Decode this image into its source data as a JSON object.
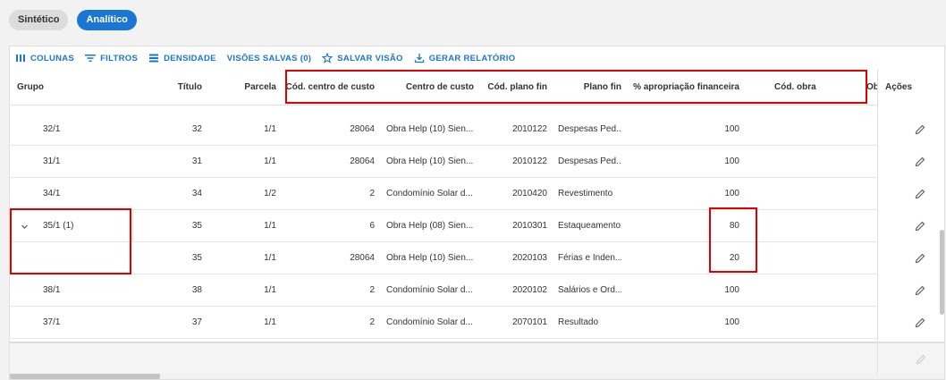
{
  "view_toggle": {
    "synthetic_label": "Sintético",
    "analytic_label": "Analítico"
  },
  "toolbar": {
    "columns_label": "COLUNAS",
    "filters_label": "FILTROS",
    "density_label": "DENSIDADE",
    "saved_views_label": "VISÕES SALVAS (0)",
    "save_view_label": "SALVAR VISÃO",
    "report_label": "GERAR RELATÓRIO"
  },
  "columns": {
    "grupo": "Grupo",
    "titulo": "Título",
    "parcela": "Parcela",
    "cod_centro": "Cód. centro de custo",
    "centro": "Centro de custo",
    "cod_plano": "Cód. plano fin",
    "plano": "Plano fin",
    "apropriacao": "% apropriação financeira",
    "cod_obra": "Cód. obra",
    "obs": "Ob",
    "acoes": "Ações"
  },
  "rows": [
    {
      "grupo": "32/1",
      "titulo": "32",
      "parcela": "1/1",
      "cod_centro": "28064",
      "centro": "Obra Help (10) Sien...",
      "cod_plano": "2010122",
      "plano": "Despesas Ped...",
      "apropriacao": "100"
    },
    {
      "grupo": "31/1",
      "titulo": "31",
      "parcela": "1/1",
      "cod_centro": "28064",
      "centro": "Obra Help (10) Sien...",
      "cod_plano": "2010122",
      "plano": "Despesas Ped...",
      "apropriacao": "100"
    },
    {
      "grupo": "34/1",
      "titulo": "34",
      "parcela": "1/2",
      "cod_centro": "2",
      "centro": "Condomínio Solar d...",
      "cod_plano": "2010420",
      "plano": "Revestimento",
      "apropriacao": "100"
    },
    {
      "grupo": "35/1 (1)",
      "titulo": "35",
      "parcela": "1/1",
      "cod_centro": "6",
      "centro": "Obra Help (08) Sien...",
      "cod_plano": "2010301",
      "plano": "Estaqueamento",
      "apropriacao": "80"
    },
    {
      "grupo": "",
      "titulo": "35",
      "parcela": "1/1",
      "cod_centro": "28064",
      "centro": "Obra Help (10) Sien...",
      "cod_plano": "2020103",
      "plano": "Férias e Inden...",
      "apropriacao": "20"
    },
    {
      "grupo": "38/1",
      "titulo": "38",
      "parcela": "1/1",
      "cod_centro": "2",
      "centro": "Condomínio Solar d...",
      "cod_plano": "2020102",
      "plano": "Salários e Ord...",
      "apropriacao": "100"
    },
    {
      "grupo": "37/1",
      "titulo": "37",
      "parcela": "1/1",
      "cod_centro": "2",
      "centro": "Condomínio Solar d...",
      "cod_plano": "2070101",
      "plano": "Resultado",
      "apropriacao": "100"
    }
  ],
  "colors": {
    "accent": "#1976d2",
    "highlight": "#e00000"
  }
}
